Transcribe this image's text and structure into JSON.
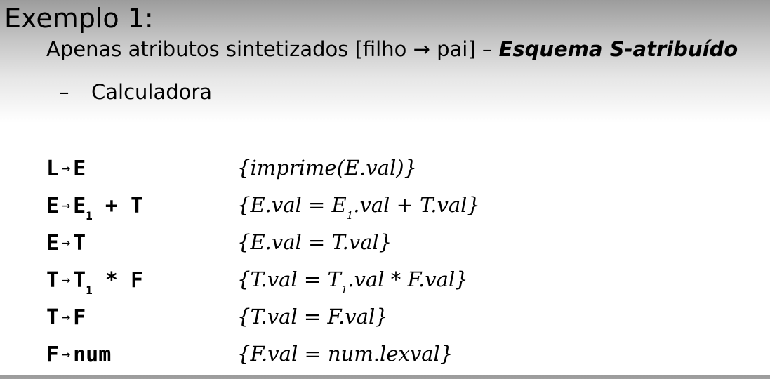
{
  "title": "Exemplo 1:",
  "subtitle": {
    "text": "Apenas atributos sintetizados [filho → pai] – ",
    "emphasis": "Esquema S-atribuído"
  },
  "bullet": {
    "marker": "–",
    "text": "Calculadora"
  },
  "rules": [
    {
      "lhs": "L",
      "arrow": "→",
      "rhs_pre": "E",
      "rhs_sub": "",
      "rhs_post": "",
      "act_pre": "{imprime(E.val)}",
      "act_eq": "",
      "act_mid": "",
      "act_sub": "",
      "act_post": ""
    },
    {
      "lhs": "E",
      "arrow": "→",
      "rhs_pre": "E",
      "rhs_sub": "1",
      "rhs_post": " + T",
      "act_pre": "{E.val ",
      "act_eq": "=",
      "act_mid": " E",
      "act_sub": "1",
      "act_post": ".val + T.val}"
    },
    {
      "lhs": "E",
      "arrow": "→",
      "rhs_pre": "T",
      "rhs_sub": "",
      "rhs_post": "",
      "act_pre": "{E.val ",
      "act_eq": "=",
      "act_mid": " T.val}",
      "act_sub": "",
      "act_post": ""
    },
    {
      "lhs": "T",
      "arrow": "→",
      "rhs_pre": "T",
      "rhs_sub": "1",
      "rhs_post": " * F",
      "act_pre": "{T.val ",
      "act_eq": "=",
      "act_mid": " T",
      "act_sub": "1",
      "act_post": ".val * F.val}"
    },
    {
      "lhs": "T",
      "arrow": "→",
      "rhs_pre": "F",
      "rhs_sub": "",
      "rhs_post": "",
      "act_pre": "{T.val ",
      "act_eq": "=",
      "act_mid": " F.val}",
      "act_sub": "",
      "act_post": ""
    },
    {
      "lhs": "F",
      "arrow": "→",
      "rhs_pre": "num",
      "rhs_sub": "",
      "rhs_post": "",
      "act_pre": "{F.val ",
      "act_eq": "=",
      "act_mid": " num.lexval}",
      "act_sub": "",
      "act_post": ""
    }
  ]
}
